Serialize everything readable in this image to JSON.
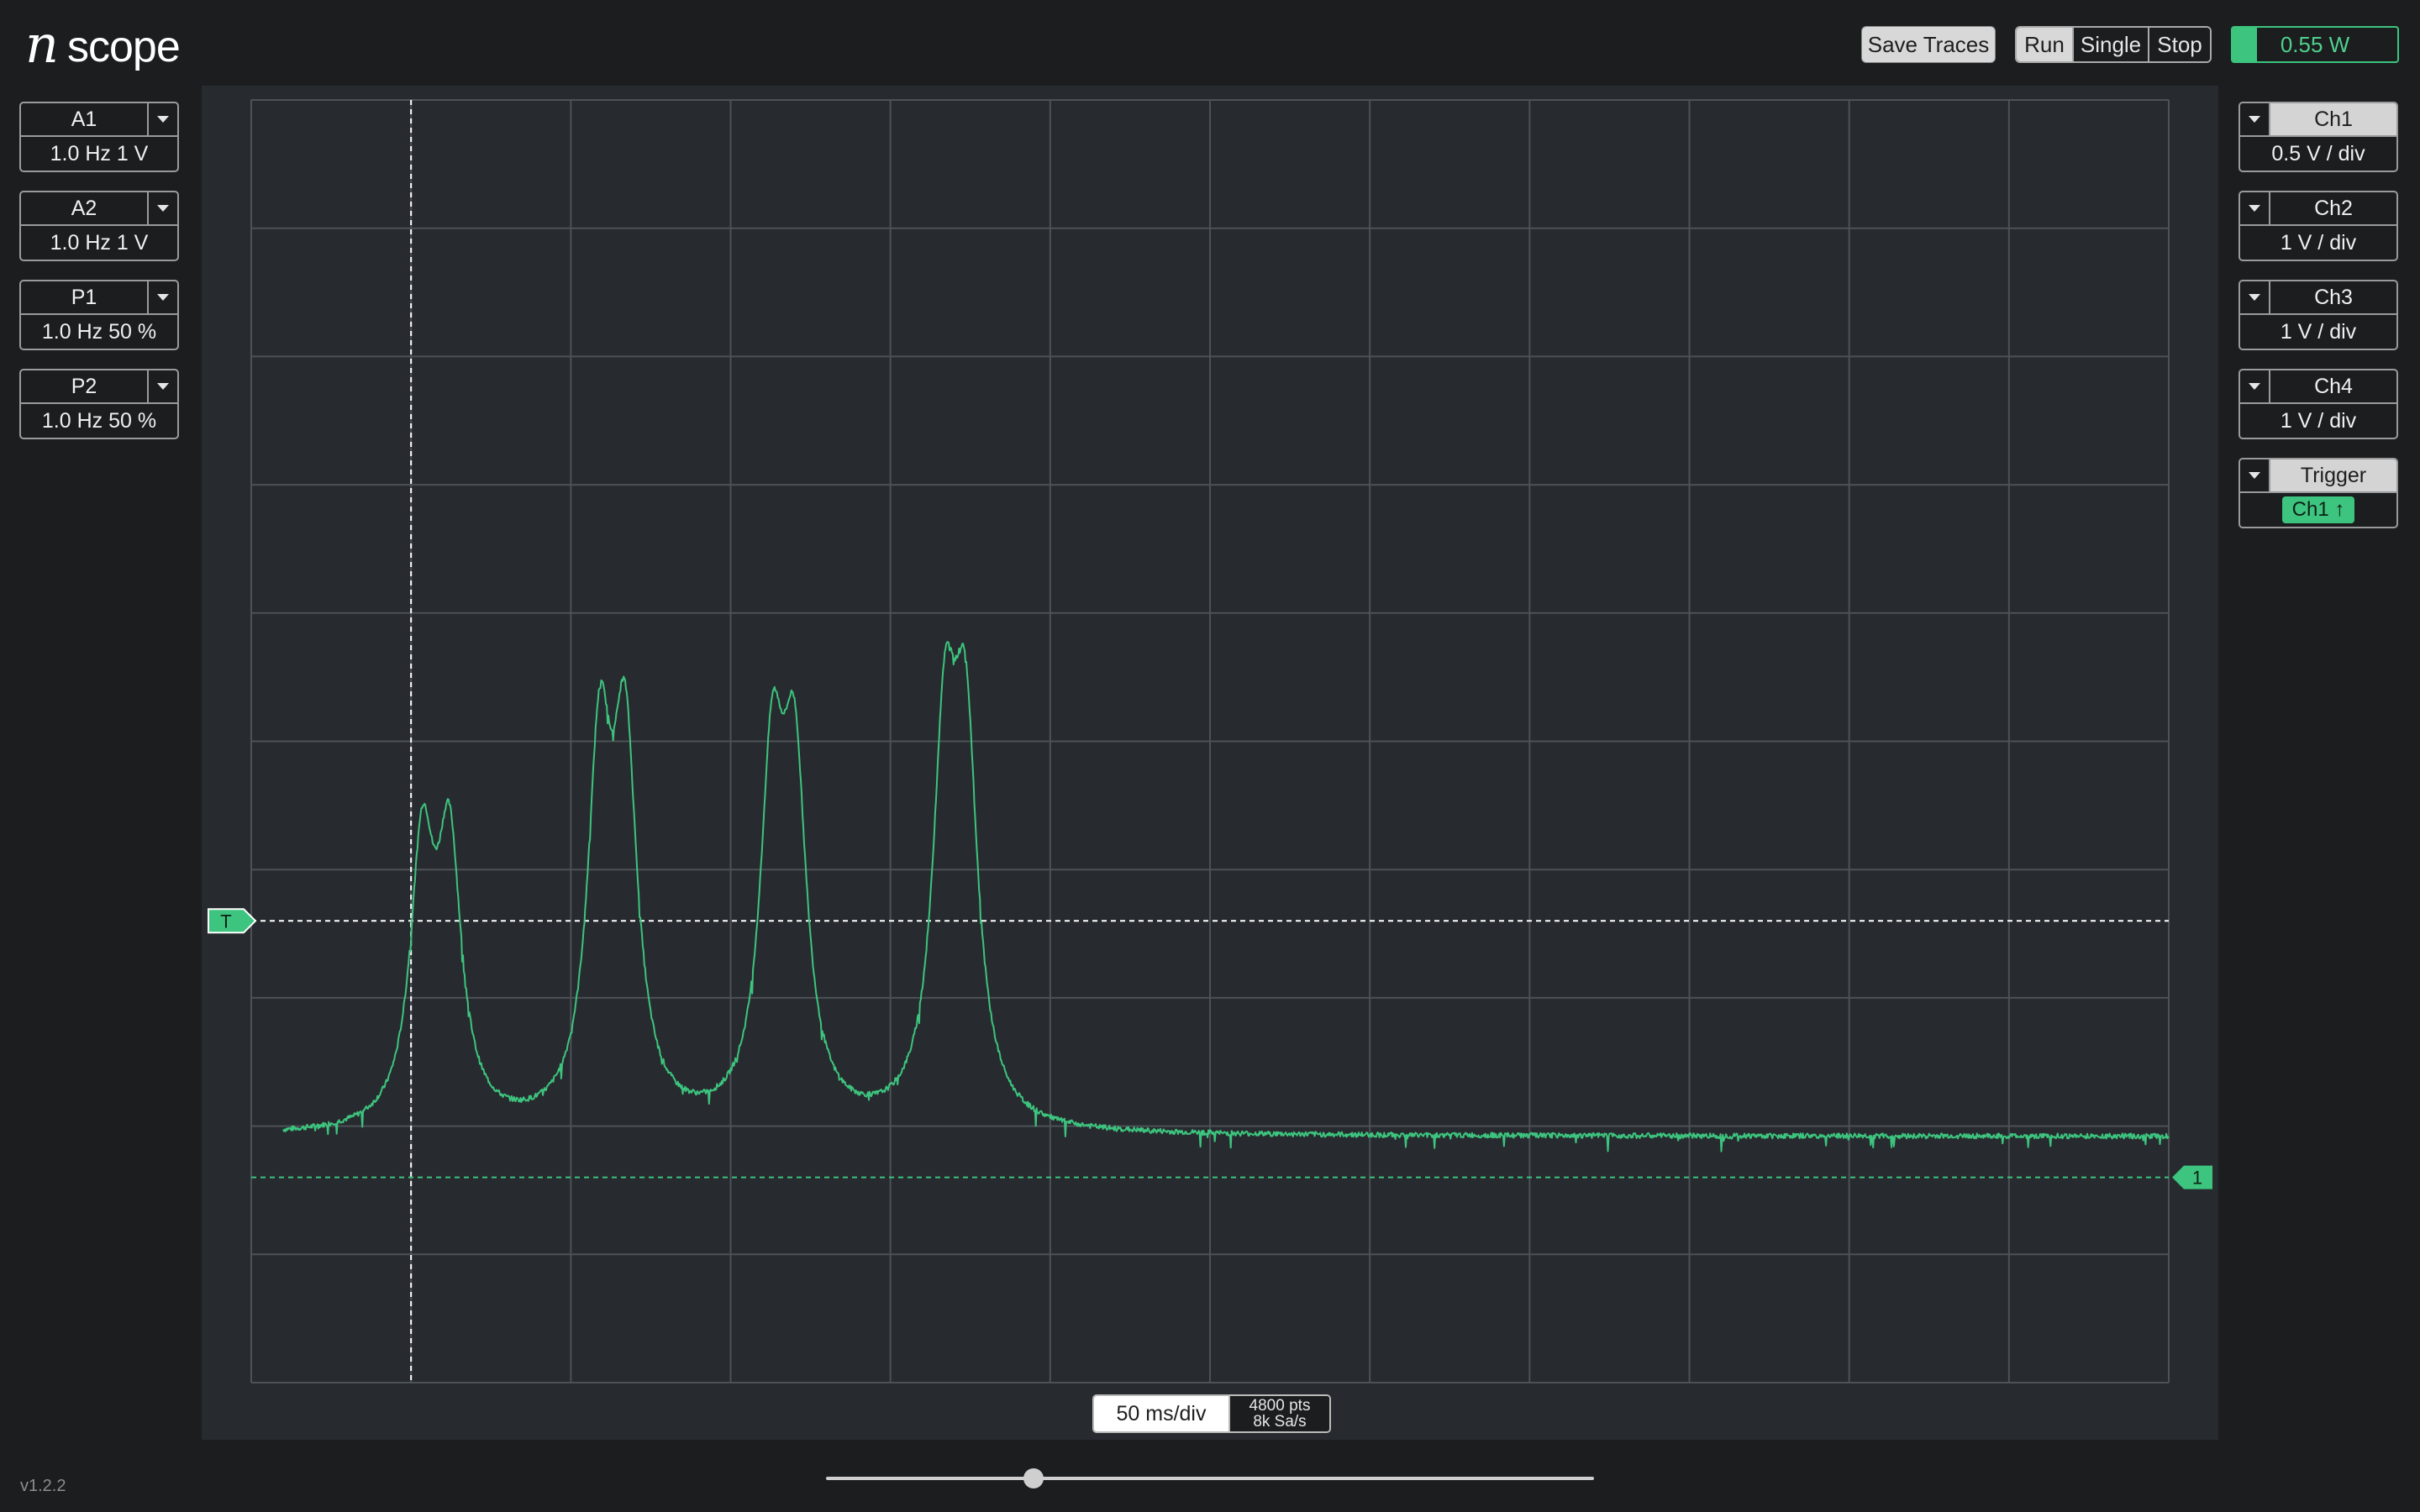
{
  "app": {
    "logo_n": "n",
    "logo_scope": "scope",
    "version": "v1.2.2"
  },
  "toolbar": {
    "save_traces": "Save Traces",
    "run": "Run",
    "single": "Single",
    "stop": "Stop",
    "power_label": "0.55 W",
    "power_fraction": 0.15
  },
  "generators": [
    {
      "name": "A1",
      "value": "1.0 Hz 1 V"
    },
    {
      "name": "A2",
      "value": "1.0 Hz 1 V"
    },
    {
      "name": "P1",
      "value": "1.0 Hz 50 %"
    },
    {
      "name": "P2",
      "value": "1.0 Hz 50 %"
    }
  ],
  "channels": [
    {
      "name": "Ch1",
      "value": "0.5 V / div",
      "active": true
    },
    {
      "name": "Ch2",
      "value": "1 V / div",
      "active": false
    },
    {
      "name": "Ch3",
      "value": "1 V / div",
      "active": false
    },
    {
      "name": "Ch4",
      "value": "1 V / div",
      "active": false
    }
  ],
  "trigger": {
    "name": "Trigger",
    "source": "Ch1 ↑",
    "marker": "T"
  },
  "timebase": {
    "div": "50 ms/div",
    "points": "4800 pts",
    "rate": "8k Sa/s",
    "scroll_position": 0.27
  },
  "ch1_marker": "1",
  "colors": {
    "trace": "#3dc47e",
    "grid": "#4d5257",
    "plot_bg": "#272b2f",
    "marker_line": "#ffffff"
  },
  "chart_data": {
    "type": "line",
    "xlabel": "",
    "ylabel": "",
    "grid": true,
    "divisions": {
      "x": 12,
      "y": 10
    },
    "x_units": "ms",
    "y_units": "V",
    "xlim": [
      -50,
      550
    ],
    "ylim": [
      -0.8,
      4.2
    ],
    "trigger_time": 0,
    "trigger_level": 1.0,
    "ch1_offset": 0,
    "series": [
      {
        "baseline": 0.16,
        "noise_amplitude": 0.02,
        "pulses": [
          {
            "t": 3.5,
            "peak": 1.2,
            "width": 4.5
          },
          {
            "t": 12,
            "peak": 1.2,
            "width": 4.5
          },
          {
            "t": 59,
            "peak": 1.54,
            "width": 4.5
          },
          {
            "t": 67,
            "peak": 1.56,
            "width": 4.5
          },
          {
            "t": 113,
            "peak": 1.46,
            "width": 4.5
          },
          {
            "t": 120,
            "peak": 1.44,
            "width": 4.5
          },
          {
            "t": 167,
            "peak": 1.56,
            "width": 4.5
          },
          {
            "t": 173.5,
            "peak": 1.56,
            "width": 4.5
          }
        ]
      }
    ]
  }
}
